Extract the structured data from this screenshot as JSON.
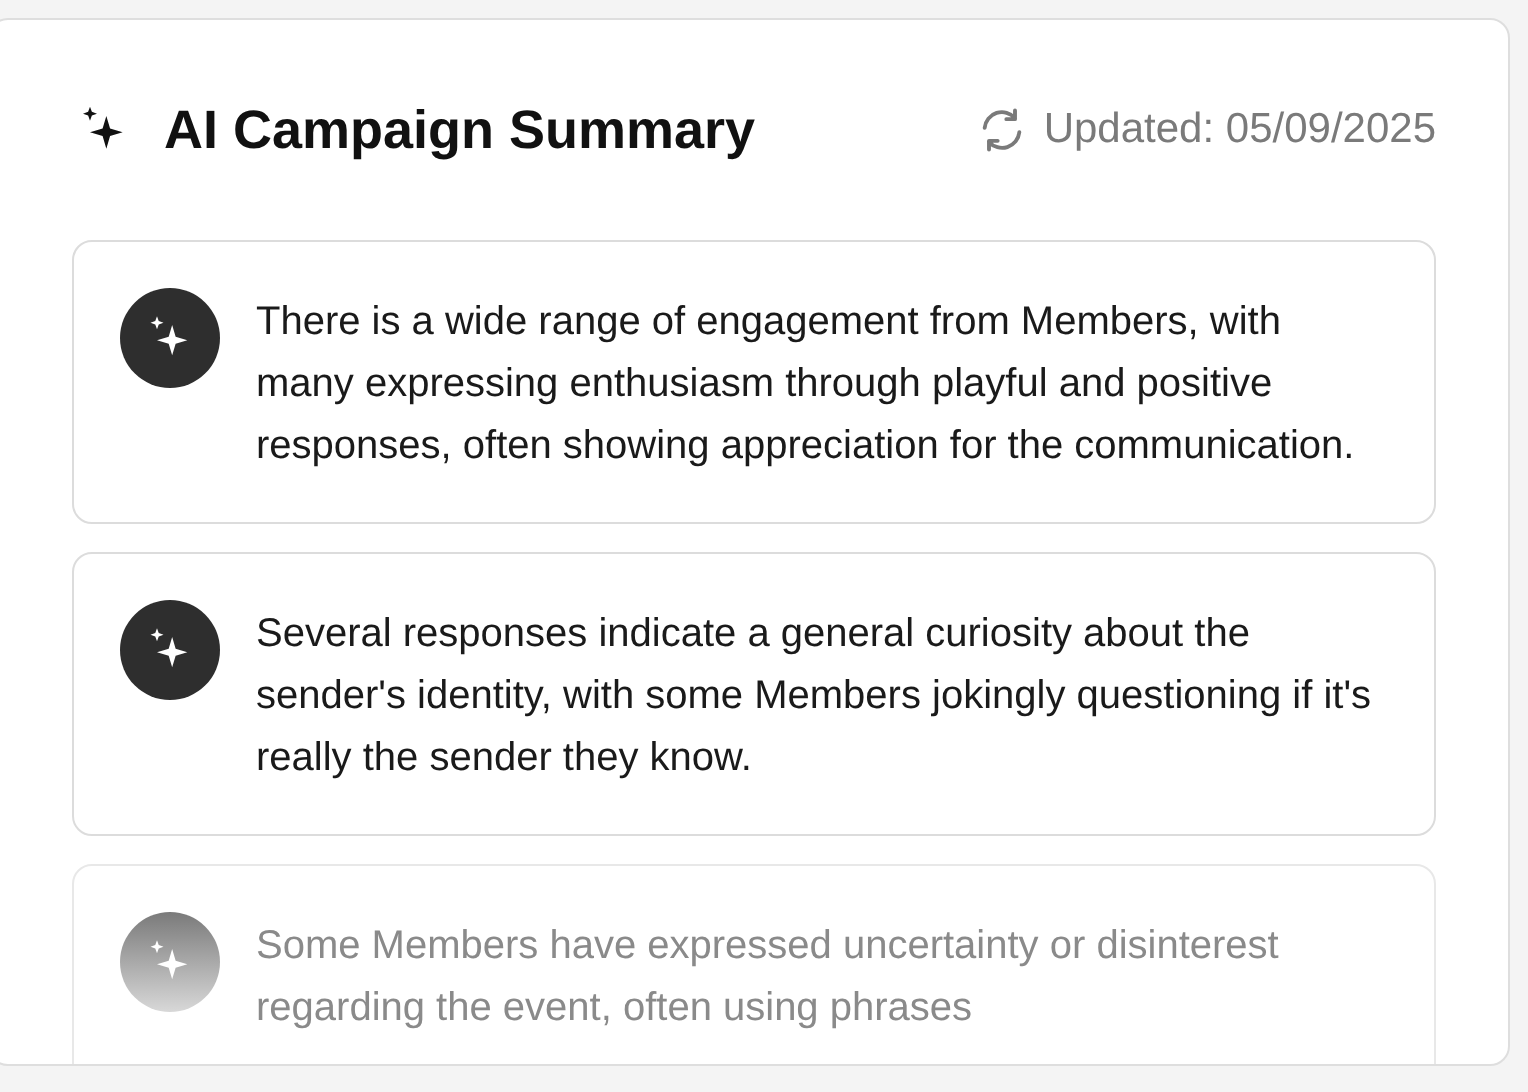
{
  "header": {
    "title": "AI Campaign Summary",
    "updated": "Updated: 05/09/2025"
  },
  "insights": [
    {
      "text": "There is a wide range of engagement from Members, with many expressing enthusiasm through playful and positive responses, often showing appreciation for the communication.",
      "faded": false
    },
    {
      "text": "Several responses indicate a general curiosity about the sender's identity, with some Members jokingly questioning if it's really the sender they know.",
      "faded": false
    },
    {
      "text": "Some Members have expressed uncertainty or disinterest regarding the event, often using phrases",
      "faded": true
    }
  ]
}
